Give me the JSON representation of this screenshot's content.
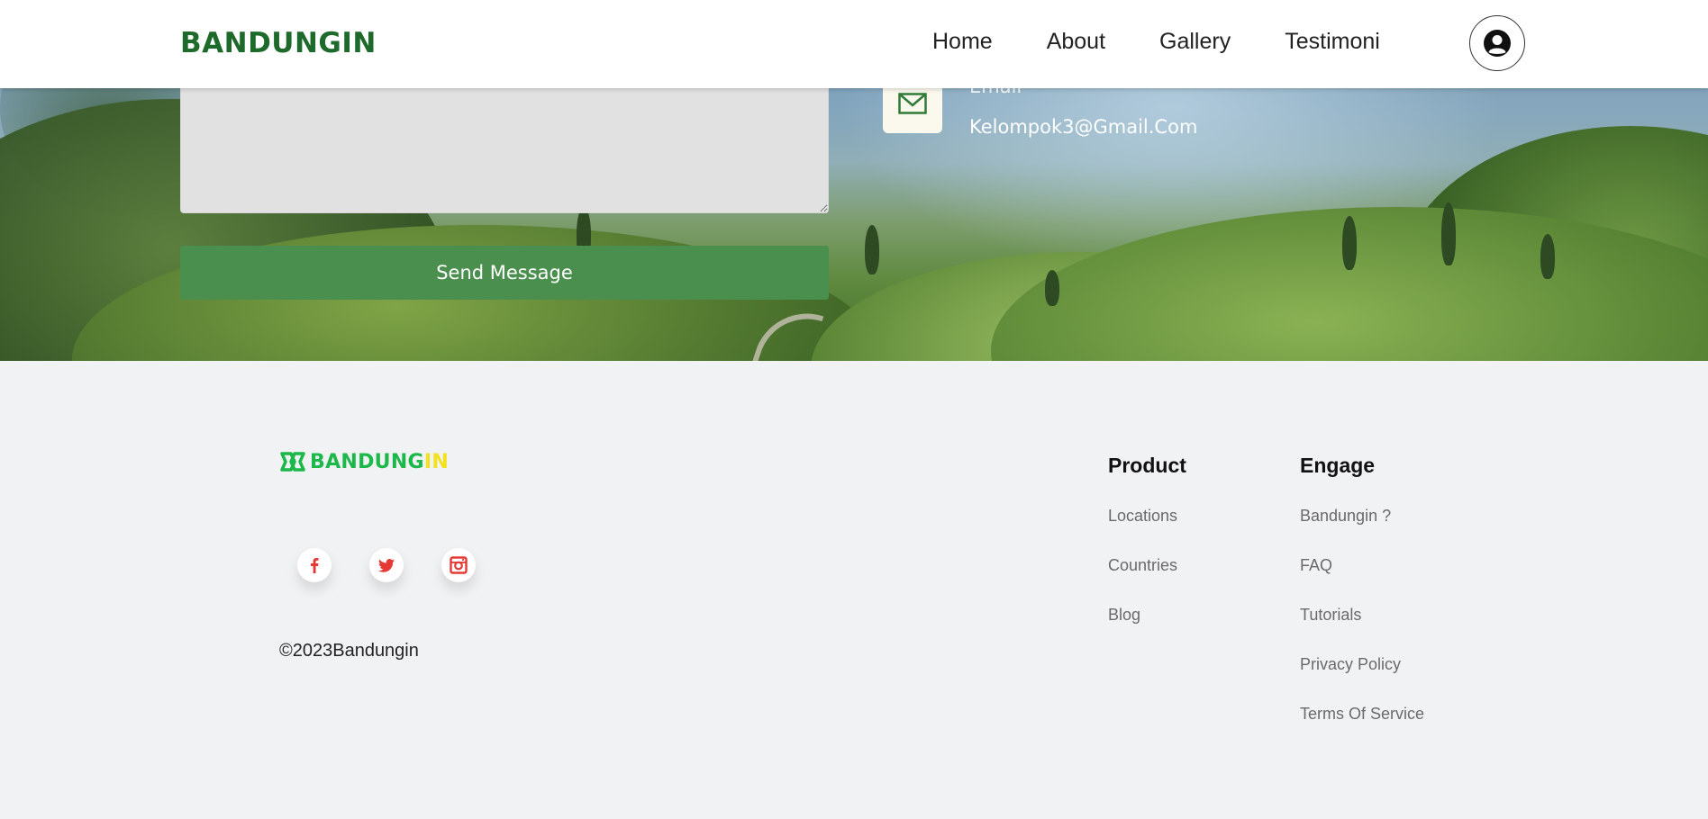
{
  "navbar": {
    "brand": "BANDUNGIN",
    "links": [
      "Home",
      "About",
      "Gallery",
      "Testimoni"
    ],
    "profile_icon": "user-circle-icon"
  },
  "contact": {
    "send_button": "Send Message",
    "email_label": "Email",
    "email_value": "Kelompok3@Gmail.Com",
    "accent_color": "#4a8f4d"
  },
  "footer": {
    "logo_part1": "BANDUNG",
    "logo_part2": "IN",
    "logo_colors": {
      "primary": "#1cb84a",
      "secondary": "#f2e11c"
    },
    "socials": [
      {
        "name": "facebook",
        "icon": "facebook-icon"
      },
      {
        "name": "twitter",
        "icon": "twitter-icon"
      },
      {
        "name": "instagram",
        "icon": "instagram-icon"
      }
    ],
    "copyright": "©2023Bandungin",
    "product": {
      "title": "Product",
      "items": [
        "Locations",
        "Countries",
        "Blog"
      ]
    },
    "engage": {
      "title": "Engage",
      "items": [
        "Bandungin ?",
        "FAQ",
        "Tutorials",
        "Privacy Policy",
        "Terms Of Service"
      ]
    }
  }
}
